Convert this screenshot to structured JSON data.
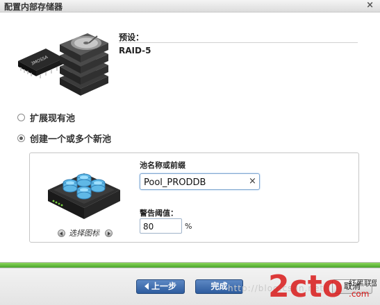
{
  "window": {
    "title": "配置内部存储器",
    "close_glyph": "×"
  },
  "preset": {
    "label": "预设：",
    "value": "RAID-5"
  },
  "options": [
    {
      "label": "扩展现有池",
      "selected": false
    },
    {
      "label": "创建一个或多个新池",
      "selected": true
    }
  ],
  "new_pool": {
    "icon_selector_label": "选择图标",
    "name_label": "池名称或前缀",
    "name_value": "Pool_PRODDB",
    "clear_glyph": "×",
    "threshold_label": "警告阈值：",
    "threshold_value": "80",
    "threshold_unit": "%"
  },
  "wizard_progress": {
    "fraction": 1.0,
    "fill_color": "#5fb83a"
  },
  "buttons": {
    "back": "上一步",
    "finish": "完成",
    "cancel": "取消"
  },
  "watermark": {
    "text": "http://blog.csdn.net/",
    "logo_text": "2cto",
    "logo_sub": "红黑联盟",
    "logo_domain": ".com"
  },
  "colors": {
    "button_blue": "#2d5c9e",
    "progress_green": "#4aa52b"
  }
}
